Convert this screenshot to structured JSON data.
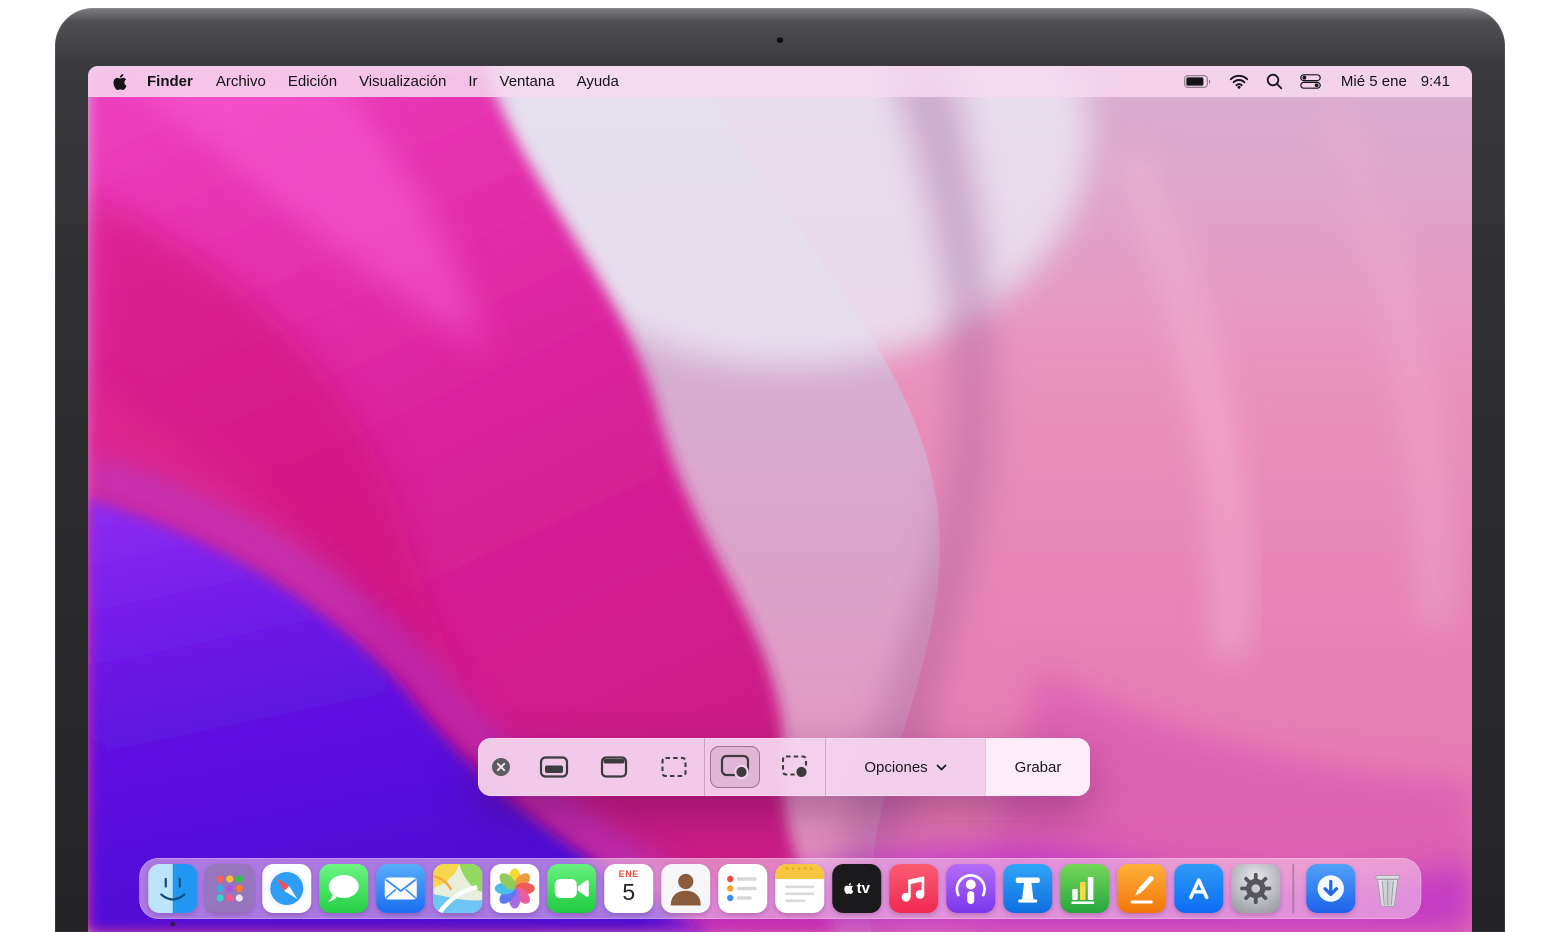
{
  "menubar": {
    "items": [
      "Finder",
      "Archivo",
      "Edición",
      "Visualización",
      "Ir",
      "Ventana",
      "Ayuda"
    ],
    "status": {
      "date": "Mié 5 ene",
      "time": "9:41"
    },
    "status_icons": [
      "battery-icon",
      "wifi-icon",
      "search-icon",
      "control-center-icon"
    ]
  },
  "capture_toolbar": {
    "close_icon": "close-icon",
    "buttons": [
      "capture-entire-screen",
      "capture-selected-window",
      "capture-selected-portion",
      "record-entire-screen",
      "record-selected-portion"
    ],
    "selected_button": "record-entire-screen",
    "options_label": "Opciones",
    "record_label": "Grabar"
  },
  "dock": {
    "items": [
      "finder",
      "launchpad",
      "safari",
      "messages",
      "mail",
      "maps",
      "photos",
      "facetime",
      "calendar",
      "contacts",
      "reminders",
      "notes",
      "tv",
      "music",
      "podcasts",
      "keynote",
      "numbers",
      "pages",
      "app-store",
      "system-preferences",
      "downloads",
      "trash"
    ],
    "calendar": {
      "month": "ENE",
      "day": "5"
    },
    "tv_label": "tv",
    "running_app": "finder"
  }
}
